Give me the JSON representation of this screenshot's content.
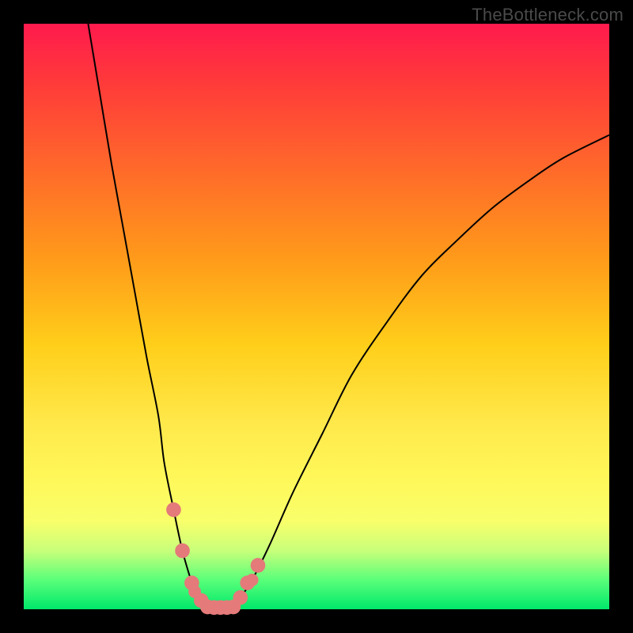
{
  "watermark": "TheBottleneck.com",
  "chart_data": {
    "type": "line",
    "title": "",
    "xlabel": "",
    "ylabel": "",
    "xlim": [
      0,
      100
    ],
    "ylim": [
      0,
      100
    ],
    "grid": false,
    "legend": false,
    "series": [
      {
        "name": "left-branch",
        "x": [
          11,
          13,
          15,
          17,
          19,
          21,
          23,
          24,
          25.6,
          27.1,
          28.7,
          29.2,
          30.3,
          31.4
        ],
        "values": [
          100,
          88,
          76,
          65,
          54,
          43,
          33,
          25,
          17,
          10,
          4.5,
          3,
          1.5,
          0.4
        ]
      },
      {
        "name": "right-branch",
        "x": [
          35.8,
          37,
          39,
          42,
          46,
          51,
          56,
          62,
          68,
          74,
          80,
          86,
          92,
          100
        ],
        "values": [
          0.4,
          2,
          5,
          11,
          20,
          30,
          40,
          49,
          57,
          63,
          68.5,
          73,
          77,
          81
        ]
      }
    ],
    "markers": {
      "name": "highlight-dots",
      "color": "#e47a7a",
      "points": [
        {
          "x": 25.6,
          "y": 17,
          "r": 1.4
        },
        {
          "x": 27.1,
          "y": 10,
          "r": 1.4
        },
        {
          "x": 28.7,
          "y": 4.5,
          "r": 1.4
        },
        {
          "x": 29.2,
          "y": 3,
          "r": 1.2
        },
        {
          "x": 30.3,
          "y": 1.5,
          "r": 1.4
        },
        {
          "x": 31.4,
          "y": 0.4,
          "r": 1.4
        },
        {
          "x": 32.5,
          "y": 0.3,
          "r": 1.4
        },
        {
          "x": 33.6,
          "y": 0.3,
          "r": 1.4
        },
        {
          "x": 34.7,
          "y": 0.3,
          "r": 1.4
        },
        {
          "x": 35.8,
          "y": 0.4,
          "r": 1.4
        },
        {
          "x": 37.0,
          "y": 2,
          "r": 1.4
        },
        {
          "x": 38.2,
          "y": 4.5,
          "r": 1.4
        },
        {
          "x": 39.0,
          "y": 5,
          "r": 1.2
        },
        {
          "x": 40.0,
          "y": 7.5,
          "r": 1.4
        }
      ]
    },
    "background_gradient": {
      "top": "#ff1a4d",
      "mid": "#ffe84a",
      "bottom": "#00e86a"
    }
  }
}
